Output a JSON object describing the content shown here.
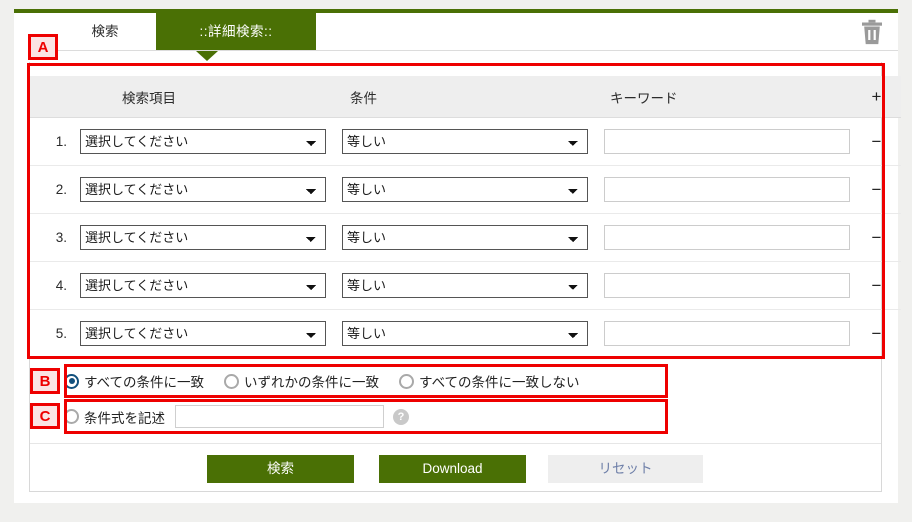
{
  "theme": {
    "accent_green": "#4a7005",
    "annotation_red": "#ee0000",
    "radio_selected_blue": "#12507d",
    "reset_text_blue": "#6e7fa8"
  },
  "tabs": [
    {
      "label": "検索",
      "active": false
    },
    {
      "label": "::詳細検索::",
      "active": true
    }
  ],
  "toolbar": {
    "trash_icon": "trash-icon"
  },
  "table": {
    "headers": {
      "number": "",
      "field": "検索項目",
      "condition": "条件",
      "keyword": "キーワード",
      "add": "+"
    },
    "remove_label": "−",
    "rows": [
      {
        "num": "1.",
        "field": "選択してください",
        "condition": "等しい",
        "keyword": "",
        "remove": "−"
      },
      {
        "num": "2.",
        "field": "選択してください",
        "condition": "等しい",
        "keyword": "",
        "remove": "−"
      },
      {
        "num": "3.",
        "field": "選択してください",
        "condition": "等しい",
        "keyword": "",
        "remove": "−"
      },
      {
        "num": "4.",
        "field": "選択してください",
        "condition": "等しい",
        "keyword": "",
        "remove": "−"
      },
      {
        "num": "5.",
        "field": "選択してください",
        "condition": "等しい",
        "keyword": "",
        "remove": "−"
      }
    ]
  },
  "match_mode": {
    "options": [
      {
        "label": "すべての条件に一致",
        "checked": true
      },
      {
        "label": "いずれかの条件に一致",
        "checked": false
      },
      {
        "label": "すべての条件に一致しない",
        "checked": false
      }
    ]
  },
  "expression": {
    "radio_label": "条件式を記述",
    "checked": false,
    "value": "",
    "placeholder": "",
    "help_icon": "help-icon",
    "help_glyph": "?"
  },
  "buttons": {
    "search": "検索",
    "download": "Download",
    "reset": "リセット"
  },
  "annotations": [
    {
      "id": "A",
      "label": "A"
    },
    {
      "id": "B",
      "label": "B"
    },
    {
      "id": "C",
      "label": "C"
    }
  ]
}
